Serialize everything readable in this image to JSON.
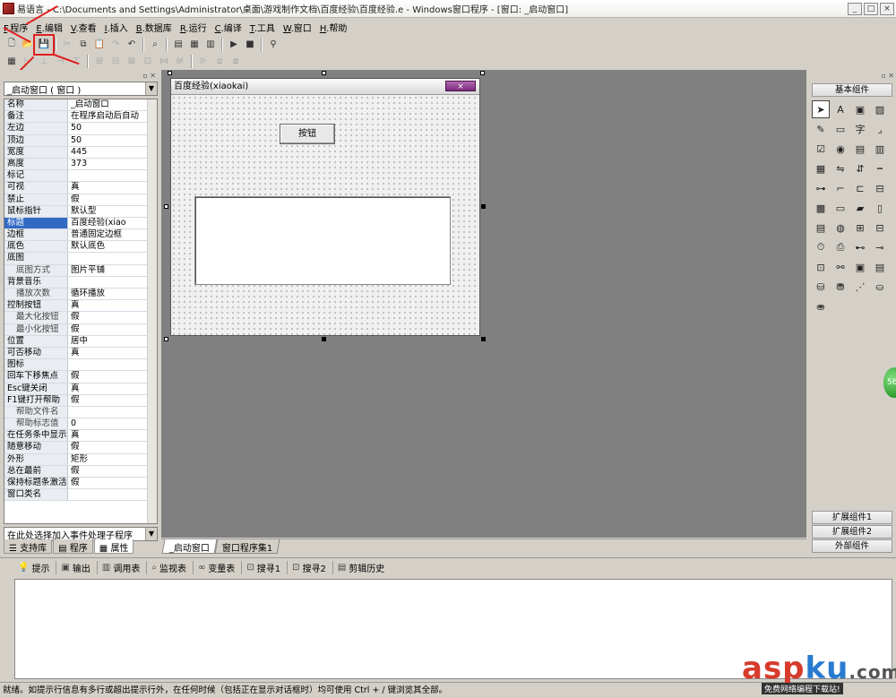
{
  "window": {
    "title": "易语言 - C:\\Documents and Settings\\Administrator\\桌面\\游戏制作文档\\百度经验\\百度经验.e - Windows窗口程序 - [窗口: _启动窗口]",
    "min": "_",
    "max": "□",
    "close": "×"
  },
  "menu": [
    {
      "key": "F",
      "label": ".程序"
    },
    {
      "key": "E",
      "label": ".编辑"
    },
    {
      "key": "V",
      "label": ".查看"
    },
    {
      "key": "I",
      "label": ".插入"
    },
    {
      "key": "B",
      "label": ".数据库"
    },
    {
      "key": "R",
      "label": ".运行"
    },
    {
      "key": "C",
      "label": ".编译"
    },
    {
      "key": "T",
      "label": ".工具"
    },
    {
      "key": "W",
      "label": ".窗口"
    },
    {
      "key": "H",
      "label": ".帮助"
    }
  ],
  "left_panel": {
    "object_selector": "_启动窗口 ( 窗口 )",
    "properties": [
      {
        "name": "名称",
        "value": "_启动窗口"
      },
      {
        "name": "备注",
        "value": "在程序启动后自动"
      },
      {
        "name": "左边",
        "value": "50"
      },
      {
        "name": "顶边",
        "value": "50"
      },
      {
        "name": "宽度",
        "value": "445"
      },
      {
        "name": "高度",
        "value": "373"
      },
      {
        "name": "标记",
        "value": ""
      },
      {
        "name": "可视",
        "value": "真"
      },
      {
        "name": "禁止",
        "value": "假"
      },
      {
        "name": "鼠标指针",
        "value": "默认型"
      },
      {
        "name": "标题",
        "value": "百度经验(xiao"
      },
      {
        "name": "边框",
        "value": "普通固定边框"
      },
      {
        "name": "底色",
        "value": "默认底色"
      },
      {
        "name": "底图",
        "value": ""
      },
      {
        "name": "底图方式",
        "value": "图片平铺"
      },
      {
        "name": "背景音乐",
        "value": ""
      },
      {
        "name": "播放次数",
        "value": "循环播放"
      },
      {
        "name": "控制按钮",
        "value": "真"
      },
      {
        "name": "最大化按钮",
        "value": "假"
      },
      {
        "name": "最小化按钮",
        "value": "假"
      },
      {
        "name": "位置",
        "value": "居中"
      },
      {
        "name": "可否移动",
        "value": "真"
      },
      {
        "name": "图标",
        "value": ""
      },
      {
        "name": "回车下移焦点",
        "value": "假"
      },
      {
        "name": "Esc键关闭",
        "value": "真"
      },
      {
        "name": "F1键打开帮助",
        "value": "假"
      },
      {
        "name": "帮助文件名",
        "value": ""
      },
      {
        "name": "帮助标志值",
        "value": "0"
      },
      {
        "name": "在任务条中显示",
        "value": "真"
      },
      {
        "name": "随意移动",
        "value": "假"
      },
      {
        "name": "外形",
        "value": "矩形"
      },
      {
        "name": "总在最前",
        "value": "假"
      },
      {
        "name": "保持标题条激活",
        "value": "假"
      },
      {
        "name": "窗口类名",
        "value": ""
      }
    ],
    "event_selector": "在此处选择加入事件处理子程序",
    "tabs": [
      "支持库",
      "程序",
      "属性"
    ]
  },
  "form": {
    "title": "百度经验(xiaokai)",
    "close_label": "×",
    "button_label": "按钮"
  },
  "design_tabs": [
    "_启动窗口",
    "窗口程序集1"
  ],
  "right_panel": {
    "basic": "基本组件",
    "ext1": "扩展组件1",
    "ext2": "扩展组件2",
    "external": "外部组件"
  },
  "green_badge": "56",
  "bottom_tabs": [
    "提示",
    "输出",
    "调用表",
    "监视表",
    "变量表",
    "搜寻1",
    "搜寻2",
    "剪辑历史"
  ],
  "status": "就绪。如提示行信息有多行或超出提示行外，在任何时候（包括正在显示对话框时）均可使用 Ctrl + / 键浏览其全部。",
  "watermark": {
    "a": "asp",
    "b": "ku",
    "c": ".com",
    "sub": "免费网络编程下载站!"
  }
}
